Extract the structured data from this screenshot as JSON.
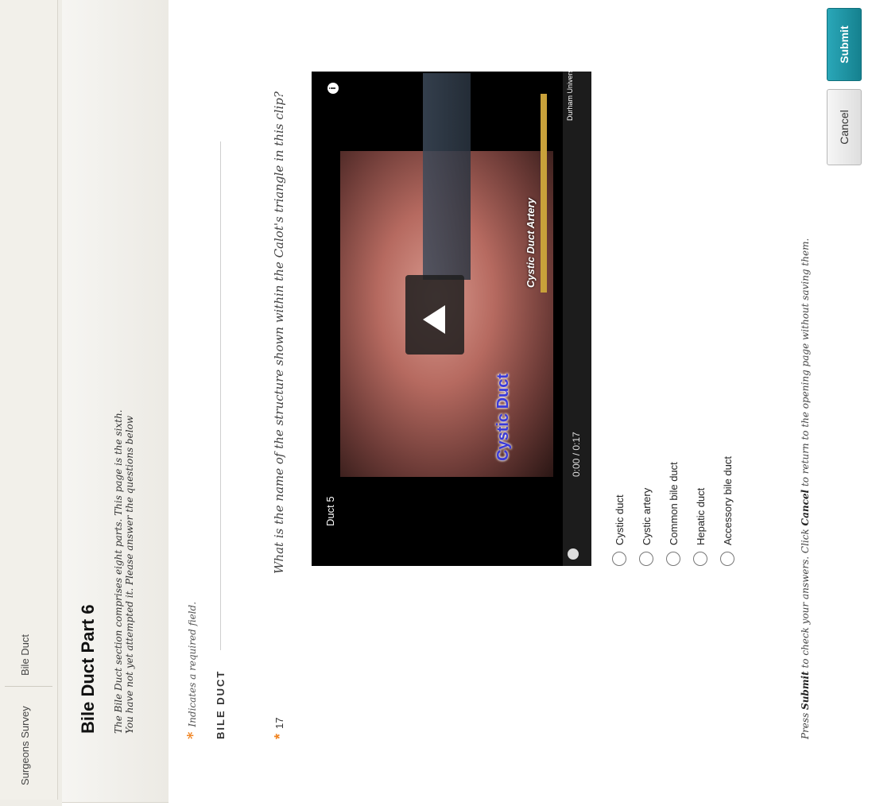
{
  "breadcrumbs": [
    "Surgeons Survey",
    "Bile Duct"
  ],
  "page": {
    "title": "Bile Duct Part 6",
    "description_line1": "The Bile Duct section comprises eight parts. This page is the sixth.",
    "description_line2": "You have not yet attempted it. Please answer the questions below"
  },
  "required_note": "Indicates a required field.",
  "required_star": "*",
  "section_label": "BILE DUCT",
  "question": {
    "number": "17",
    "text": "What is the name of the structure shown within the Calot's triangle in this clip?"
  },
  "video": {
    "title": "Duct 5",
    "time": "0:00 / 0:17",
    "overlay_label_1": "Cystic Duct",
    "overlay_label_2": "Cystic Duct Artery",
    "logo": "Durham University",
    "info_icon": "i"
  },
  "options": [
    "Cystic duct",
    "Cystic artery",
    "Common bile duct",
    "Hepatic duct",
    "Accessory bile duct"
  ],
  "footer": {
    "prefix": "Press ",
    "submit_word": "Submit",
    "middle": " to check your answers. Click ",
    "cancel_word": "Cancel",
    "suffix": " to return to the opening page without saving them."
  },
  "buttons": {
    "cancel": "Cancel",
    "submit": "Submit"
  },
  "colors": {
    "accent": "#1a8e9d",
    "required": "#f0821e"
  }
}
